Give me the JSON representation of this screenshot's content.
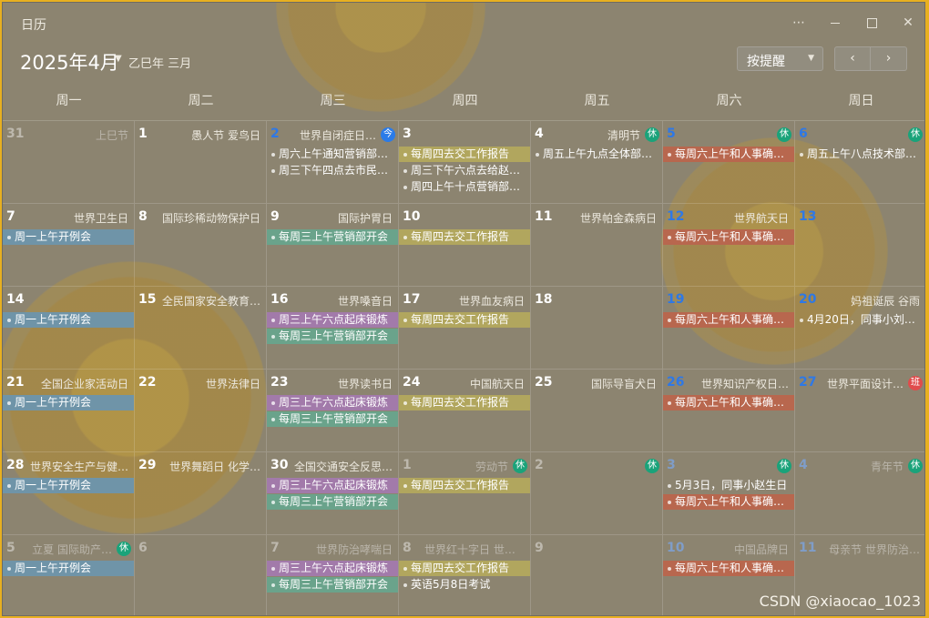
{
  "window": {
    "title": "日历"
  },
  "header": {
    "month": "2025年4月",
    "lunar": "乙巳年 三月",
    "filter_label": "按提醒",
    "more": "⋯",
    "close": "✕"
  },
  "weekdays": [
    "周一",
    "周二",
    "周三",
    "周四",
    "周五",
    "周六",
    "周日"
  ],
  "colors": {
    "blue": "#6f94a8",
    "olive": "#b1a65e",
    "teal": "#6aa38b",
    "red": "#b8674e",
    "purple": "#a27aaa",
    "rest": "#1aa37a",
    "work": "#e04c4c",
    "today": "#2b7be8"
  },
  "weeks": [
    [
      {
        "day": "31",
        "other": true,
        "fest": "上巳节",
        "events": []
      },
      {
        "day": "1",
        "fest": "愚人节 爱鸟日",
        "events": []
      },
      {
        "day": "2",
        "blue": true,
        "fest": "世界自闭症日…",
        "badge": "今",
        "badge_type": "today",
        "events": [
          {
            "text": "周六上午通知营销部…",
            "style": "plain"
          },
          {
            "text": "周三下午四点去市民…",
            "style": "plain"
          }
        ]
      },
      {
        "day": "3",
        "fest": "",
        "events": [
          {
            "text": "每周四去交工作报告",
            "style": "olive"
          },
          {
            "text": "周三下午六点去给赵…",
            "style": "plain"
          },
          {
            "text": "周四上午十点营销部…",
            "style": "plain"
          }
        ]
      },
      {
        "day": "4",
        "fest": "清明节",
        "badge": "休",
        "badge_type": "rest",
        "events": [
          {
            "text": "周五上午九点全体部…",
            "style": "plain"
          }
        ]
      },
      {
        "day": "5",
        "blue": true,
        "fest": "",
        "badge": "休",
        "badge_type": "rest",
        "events": [
          {
            "text": "每周六上午和人事确…",
            "style": "red"
          }
        ]
      },
      {
        "day": "6",
        "blue": true,
        "fest": "",
        "badge": "休",
        "badge_type": "rest",
        "events": [
          {
            "text": "周五上午八点技术部…",
            "style": "plain"
          }
        ]
      }
    ],
    [
      {
        "day": "7",
        "fest": "世界卫生日",
        "events": [
          {
            "text": "周一上午开例会",
            "style": "blue"
          }
        ]
      },
      {
        "day": "8",
        "fest": "国际珍稀动物保护日",
        "events": []
      },
      {
        "day": "9",
        "fest": "国际护胃日",
        "events": [
          {
            "text": "每周三上午营销部开会",
            "style": "teal"
          }
        ]
      },
      {
        "day": "10",
        "fest": "",
        "events": [
          {
            "text": "每周四去交工作报告",
            "style": "olive"
          }
        ]
      },
      {
        "day": "11",
        "fest": "世界帕金森病日",
        "events": []
      },
      {
        "day": "12",
        "blue": true,
        "fest": "世界航天日",
        "events": [
          {
            "text": "每周六上午和人事确…",
            "style": "red"
          }
        ]
      },
      {
        "day": "13",
        "blue": true,
        "fest": "",
        "events": []
      }
    ],
    [
      {
        "day": "14",
        "fest": "",
        "events": [
          {
            "text": "周一上午开例会",
            "style": "blue"
          }
        ]
      },
      {
        "day": "15",
        "fest": "全民国家安全教育…",
        "events": []
      },
      {
        "day": "16",
        "fest": "世界嗓音日",
        "events": [
          {
            "text": "周三上午六点起床锻炼",
            "style": "purple"
          },
          {
            "text": "每周三上午营销部开会",
            "style": "teal"
          }
        ]
      },
      {
        "day": "17",
        "fest": "世界血友病日",
        "events": [
          {
            "text": "每周四去交工作报告",
            "style": "olive"
          }
        ]
      },
      {
        "day": "18",
        "fest": "",
        "events": []
      },
      {
        "day": "19",
        "blue": true,
        "fest": "",
        "events": [
          {
            "text": "每周六上午和人事确…",
            "style": "red"
          }
        ]
      },
      {
        "day": "20",
        "blue": true,
        "fest": "妈祖诞辰 谷雨",
        "events": [
          {
            "text": "4月20日，同事小刘…",
            "style": "plain"
          }
        ]
      }
    ],
    [
      {
        "day": "21",
        "fest": "全国企业家活动日",
        "events": [
          {
            "text": "周一上午开例会",
            "style": "blue"
          }
        ]
      },
      {
        "day": "22",
        "fest": "世界法律日",
        "events": []
      },
      {
        "day": "23",
        "fest": "世界读书日",
        "events": [
          {
            "text": "周三上午六点起床锻炼",
            "style": "purple"
          },
          {
            "text": "每周三上午营销部开会",
            "style": "teal"
          }
        ]
      },
      {
        "day": "24",
        "fest": "中国航天日",
        "events": [
          {
            "text": "每周四去交工作报告",
            "style": "olive"
          }
        ]
      },
      {
        "day": "25",
        "fest": "国际导盲犬日",
        "events": []
      },
      {
        "day": "26",
        "blue": true,
        "fest": "世界知识产权日…",
        "events": [
          {
            "text": "每周六上午和人事确…",
            "style": "red"
          }
        ]
      },
      {
        "day": "27",
        "blue": true,
        "fest": "世界平面设计…",
        "badge": "班",
        "badge_type": "work",
        "events": []
      }
    ],
    [
      {
        "day": "28",
        "fest": "世界安全生产与健…",
        "events": [
          {
            "text": "周一上午开例会",
            "style": "blue"
          }
        ]
      },
      {
        "day": "29",
        "fest": "世界舞蹈日 化学…",
        "events": []
      },
      {
        "day": "30",
        "fest": "全国交通安全反思…",
        "events": [
          {
            "text": "周三上午六点起床锻炼",
            "style": "purple"
          },
          {
            "text": "每周三上午营销部开会",
            "style": "teal"
          }
        ]
      },
      {
        "day": "1",
        "other": true,
        "fest": "劳动节",
        "badge": "休",
        "badge_type": "rest",
        "events": [
          {
            "text": "每周四去交工作报告",
            "style": "olive"
          }
        ]
      },
      {
        "day": "2",
        "other": true,
        "fest": "",
        "badge": "休",
        "badge_type": "rest",
        "events": []
      },
      {
        "day": "3",
        "other": true,
        "blue": true,
        "fest": "",
        "badge": "休",
        "badge_type": "rest",
        "events": [
          {
            "text": "5月3日，同事小赵生日",
            "style": "plain"
          },
          {
            "text": "每周六上午和人事确…",
            "style": "red"
          }
        ]
      },
      {
        "day": "4",
        "other": true,
        "blue": true,
        "fest": "青年节",
        "badge": "休",
        "badge_type": "rest",
        "events": []
      }
    ],
    [
      {
        "day": "5",
        "other": true,
        "fest": "立夏 国际助产…",
        "badge": "休",
        "badge_type": "rest",
        "events": [
          {
            "text": "周一上午开例会",
            "style": "blue"
          }
        ]
      },
      {
        "day": "6",
        "other": true,
        "fest": "",
        "events": []
      },
      {
        "day": "7",
        "other": true,
        "fest": "世界防治哮喘日",
        "events": [
          {
            "text": "周三上午六点起床锻炼",
            "style": "purple"
          },
          {
            "text": "每周三上午营销部开会",
            "style": "teal"
          }
        ]
      },
      {
        "day": "8",
        "other": true,
        "fest": "世界红十字日 世界…",
        "events": [
          {
            "text": "每周四去交工作报告",
            "style": "olive"
          },
          {
            "text": "英语5月8日考试",
            "style": "plain"
          }
        ]
      },
      {
        "day": "9",
        "other": true,
        "fest": "",
        "events": []
      },
      {
        "day": "10",
        "other": true,
        "blue": true,
        "fest": "中国品牌日",
        "events": [
          {
            "text": "每周六上午和人事确…",
            "style": "red"
          }
        ]
      },
      {
        "day": "11",
        "other": true,
        "blue": true,
        "fest": "母亲节 世界防治…",
        "events": []
      }
    ]
  ],
  "watermark": "CSDN @xiaocao_1023"
}
